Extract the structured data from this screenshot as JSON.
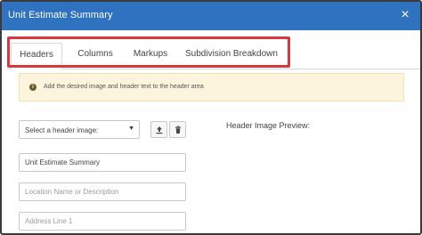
{
  "window": {
    "title": "Unit Estimate Summary",
    "close_glyph": "×"
  },
  "tabs": [
    {
      "label": "Headers",
      "active": true
    },
    {
      "label": "Columns",
      "active": false
    },
    {
      "label": "Markups",
      "active": false
    },
    {
      "label": "Subdivision Breakdown",
      "active": false
    }
  ],
  "alert": {
    "icon": "info-icon",
    "text": "Add the desired image and header text to the header area"
  },
  "header_image_select": {
    "value": "Select a header image:"
  },
  "buttons": {
    "upload_icon": "upload-icon",
    "delete_icon": "trash-icon"
  },
  "preview": {
    "label": "Header Image Preview:"
  },
  "fields": {
    "title": {
      "value": "Unit Estimate Summary",
      "placeholder": ""
    },
    "location": {
      "value": "",
      "placeholder": "Location Name or Description"
    },
    "address1": {
      "value": "",
      "placeholder": "Address Line 1"
    }
  },
  "colors": {
    "titlebar": "#2f72c0",
    "highlight": "#d9363e",
    "alert_bg": "#fcf4dc"
  }
}
